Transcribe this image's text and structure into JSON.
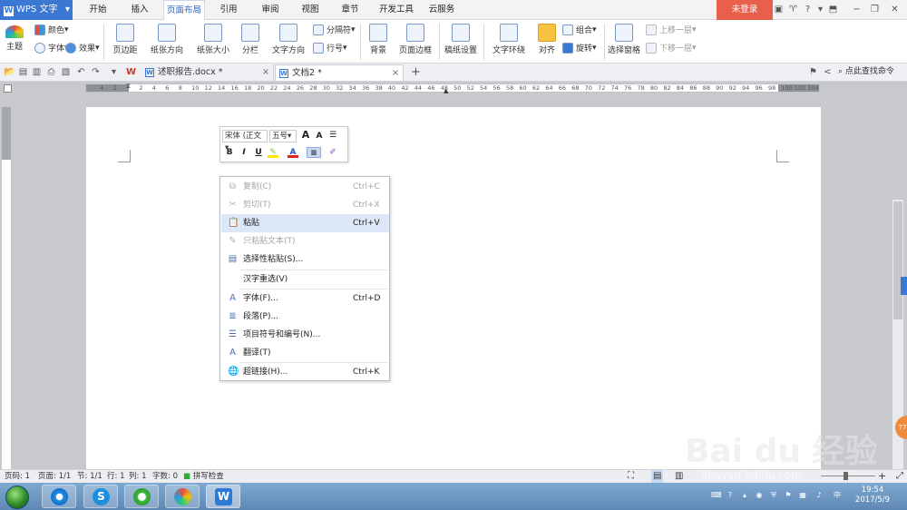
{
  "app": {
    "name": "WPS 文字",
    "login": "未登录"
  },
  "tabs": [
    "开始",
    "插入",
    "页面布局",
    "引用",
    "审阅",
    "视图",
    "章节",
    "开发工具",
    "云服务"
  ],
  "active_tab": "页面布局",
  "ribbon": {
    "theme": "主题",
    "colors": "颜色",
    "fonts": "字体",
    "effects": "效果",
    "margins": "页边距",
    "orientation": "纸张方向",
    "size": "纸张大小",
    "columns": "分栏",
    "text_direction": "文字方向",
    "breaks": "分隔符",
    "line_numbers": "行号",
    "background": "背景",
    "page_border": "页面边框",
    "draft_paper": "稿纸设置",
    "wrap_text": "文字环绕",
    "align": "对齐",
    "group": "组合",
    "rotate": "旋转",
    "selection_pane": "选择窗格",
    "bring_forward": "上移一层",
    "send_backward": "下移一层"
  },
  "doc_tabs": [
    {
      "name": "述职报告.docx *",
      "active": false
    },
    {
      "name": "文档2 *",
      "active": true
    }
  ],
  "search_command": "点此查找命令",
  "ruler": {
    "h_ticks": [
      "4",
      "2",
      "",
      "2",
      "4",
      "6",
      "8",
      "10",
      "12",
      "14",
      "16",
      "18",
      "20",
      "22",
      "24",
      "26",
      "28",
      "30",
      "32",
      "34",
      "36",
      "38",
      "40",
      "42",
      "44",
      "46",
      "48",
      "50",
      "52",
      "54",
      "56",
      "58",
      "60",
      "62",
      "64",
      "66",
      "68",
      "70",
      "72",
      "74",
      "76",
      "78",
      "80",
      "82",
      "84",
      "86",
      "88",
      "90",
      "92",
      "94",
      "96",
      "98",
      "100",
      "102",
      "104"
    ]
  },
  "mini_toolbar": {
    "font": "宋体 (正文",
    "size": "五号",
    "bold": "B",
    "italic": "I",
    "underline": "U",
    "grow": "A",
    "shrink": "A"
  },
  "context_menu": [
    {
      "label": "复制(C)",
      "shortcut": "Ctrl+C",
      "icon": "copy-icon",
      "disabled": true
    },
    {
      "label": "剪切(T)",
      "shortcut": "Ctrl+X",
      "icon": "cut-icon",
      "disabled": true
    },
    {
      "label": "粘贴",
      "shortcut": "Ctrl+V",
      "icon": "paste-icon",
      "highlighted": true
    },
    {
      "label": "只粘贴文本(T)",
      "shortcut": "",
      "icon": "paste-text-icon",
      "disabled": true
    },
    {
      "label": "选择性粘贴(S)...",
      "shortcut": "",
      "icon": "paste-special-icon"
    },
    {
      "label": "汉字重选(V)",
      "shortcut": "",
      "icon": ""
    },
    {
      "label": "字体(F)...",
      "shortcut": "Ctrl+D",
      "icon": "font-icon"
    },
    {
      "label": "段落(P)...",
      "shortcut": "",
      "icon": "paragraph-icon"
    },
    {
      "label": "项目符号和编号(N)...",
      "shortcut": "",
      "icon": "bullets-icon"
    },
    {
      "label": "翻译(T)",
      "shortcut": "",
      "icon": "translate-icon"
    },
    {
      "label": "超链接(H)...",
      "shortcut": "Ctrl+K",
      "icon": "hyperlink-icon"
    }
  ],
  "status": {
    "page_num": "页码: 1",
    "pages": "页面: 1/1",
    "section": "节: 1/1",
    "row": "行: 1",
    "col": "列: 1",
    "words": "字数: 0",
    "spellcheck": "拼写检查"
  },
  "taskbar": {
    "time": "19:54",
    "date": "2017/5/9"
  },
  "watermark": {
    "brand": "Bai du 经验",
    "url": "jingyan.baidu.com"
  },
  "float_badge": "77",
  "colors": {
    "accent": "#3a78d4",
    "login": "#e8604c",
    "highlight": "#dce8f8"
  }
}
